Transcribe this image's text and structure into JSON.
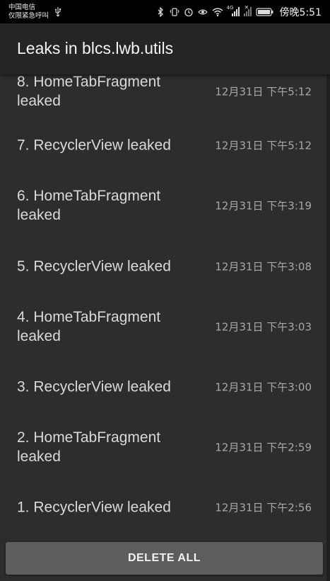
{
  "status_bar": {
    "carrier_line1": "中国电信",
    "carrier_line2": "仅限紧急呼叫",
    "network_label": "4G",
    "time": "傍晚5:51",
    "icons": [
      "usb-icon",
      "bluetooth-icon",
      "vibrate-icon",
      "alarm-icon",
      "eye-icon",
      "wifi-icon",
      "signal-icon",
      "no-sim-icon",
      "battery-icon"
    ]
  },
  "app_bar": {
    "title": "Leaks in blcs.lwb.utils"
  },
  "leaks": [
    {
      "label": "8. HomeTabFragment leaked",
      "time": "12月31日 下午5:12"
    },
    {
      "label": "7. RecyclerView leaked",
      "time": "12月31日 下午5:12"
    },
    {
      "label": "6. HomeTabFragment leaked",
      "time": "12月31日 下午3:19"
    },
    {
      "label": "5. RecyclerView leaked",
      "time": "12月31日 下午3:08"
    },
    {
      "label": "4. HomeTabFragment leaked",
      "time": "12月31日 下午3:03"
    },
    {
      "label": "3. RecyclerView leaked",
      "time": "12月31日 下午3:00"
    },
    {
      "label": "2. HomeTabFragment leaked",
      "time": "12月31日 下午2:59"
    },
    {
      "label": "1. RecyclerView leaked",
      "time": "12月31日 下午2:56"
    }
  ],
  "actions": {
    "delete_all_label": "DELETE ALL"
  }
}
